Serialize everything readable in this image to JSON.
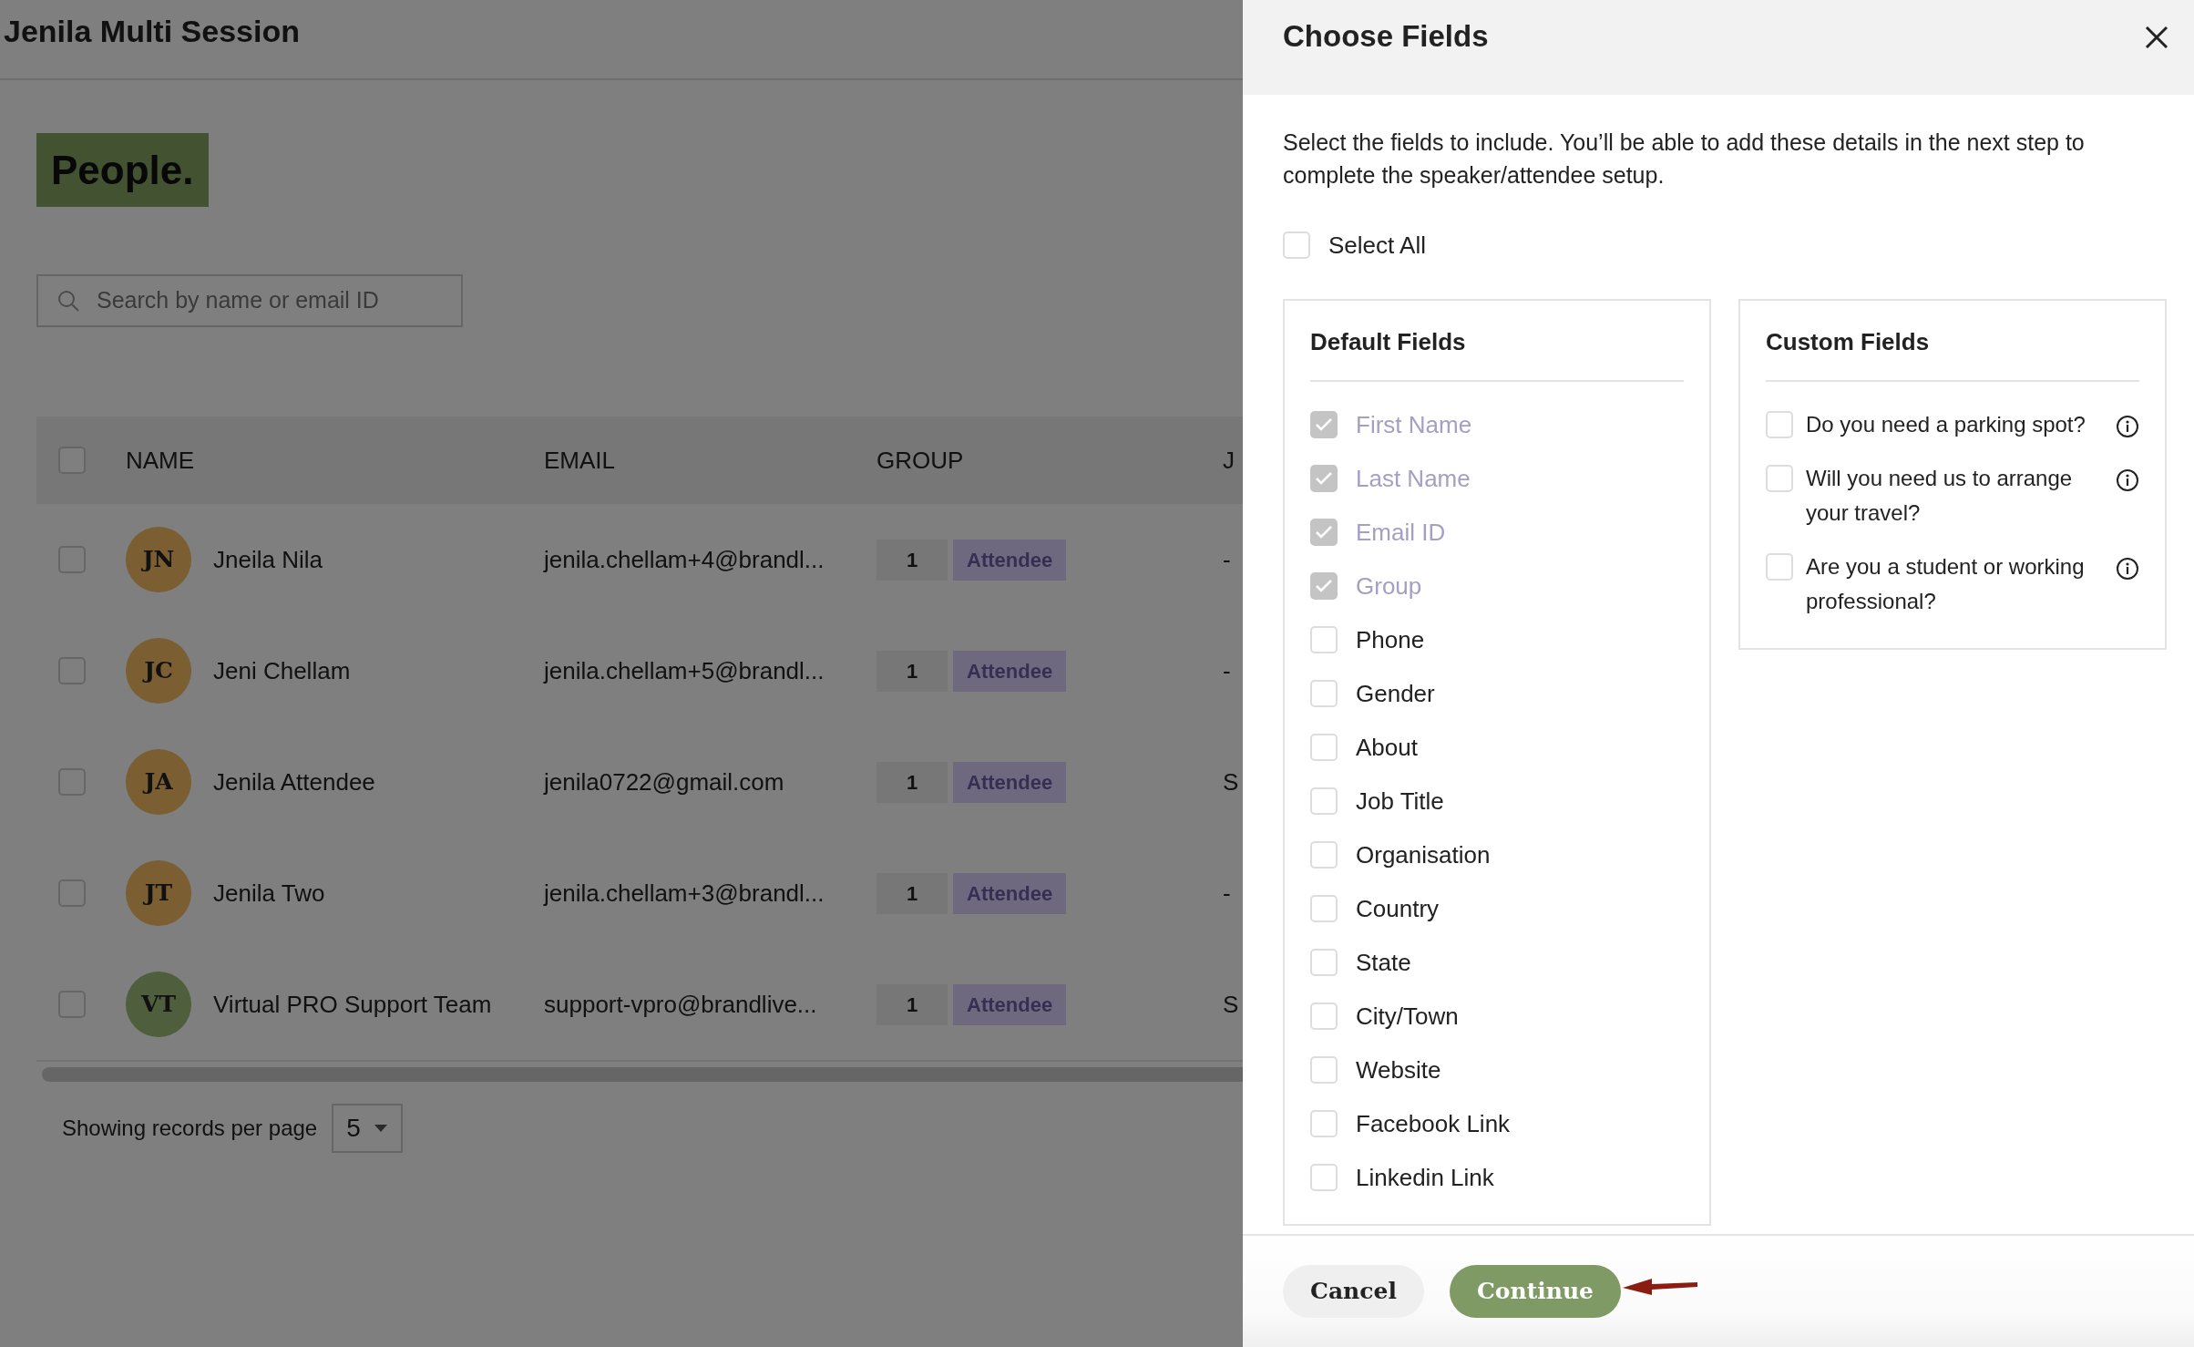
{
  "page": {
    "title": "Jenila Multi Session",
    "heading": "People.",
    "search": {
      "placeholder": "Search by name or email ID"
    },
    "table": {
      "select_all_checked": false,
      "columns": [
        "NAME",
        "EMAIL",
        "GROUP",
        "J"
      ],
      "rows": [
        {
          "checked": false,
          "initials": "JN",
          "color": "#7b5e31",
          "name": "Jneila Nila",
          "email": "jenila.chellam+4@brandl...",
          "group_count": "1",
          "group": "Attendee",
          "column_4": "-"
        },
        {
          "checked": false,
          "initials": "JC",
          "color": "#7b5e31",
          "name": "Jeni Chellam",
          "email": "jenila.chellam+5@brandl...",
          "group_count": "1",
          "group": "Attendee",
          "column_4": "-"
        },
        {
          "checked": false,
          "initials": "JA",
          "color": "#7b5e31",
          "name": "Jenila Attendee",
          "email": "jenila0722@gmail.com",
          "group_count": "1",
          "group": "Attendee",
          "column_4": "S"
        },
        {
          "checked": false,
          "initials": "JT",
          "color": "#7b5e31",
          "name": "Jenila Two",
          "email": "jenila.chellam+3@brandl...",
          "group_count": "1",
          "group": "Attendee",
          "column_4": "-"
        },
        {
          "checked": false,
          "initials": "VT",
          "color": "#4f5e3c",
          "name": "Virtual PRO Support Team",
          "email": "support-vpro@brandlive...",
          "group_count": "1",
          "group": "Attendee",
          "column_4": "S"
        }
      ]
    },
    "pagination": {
      "label": "Showing records per page",
      "per_page": "5"
    }
  },
  "drawer": {
    "title": "Choose Fields",
    "description": "Select the fields to include. You’ll be able to add these details in the next step to complete the speaker/attendee setup.",
    "select_all": {
      "label": "Select All",
      "checked": false
    },
    "default_fields": {
      "title": "Default Fields",
      "items": [
        {
          "label": "First Name",
          "checked": true,
          "disabled": true
        },
        {
          "label": "Last Name",
          "checked": true,
          "disabled": true
        },
        {
          "label": "Email ID",
          "checked": true,
          "disabled": true
        },
        {
          "label": "Group",
          "checked": true,
          "disabled": true
        },
        {
          "label": "Phone",
          "checked": false,
          "disabled": false
        },
        {
          "label": "Gender",
          "checked": false,
          "disabled": false
        },
        {
          "label": "About",
          "checked": false,
          "disabled": false
        },
        {
          "label": "Job Title",
          "checked": false,
          "disabled": false
        },
        {
          "label": "Organisation",
          "checked": false,
          "disabled": false
        },
        {
          "label": "Country",
          "checked": false,
          "disabled": false
        },
        {
          "label": "State",
          "checked": false,
          "disabled": false
        },
        {
          "label": "City/Town",
          "checked": false,
          "disabled": false
        },
        {
          "label": "Website",
          "checked": false,
          "disabled": false
        },
        {
          "label": "Facebook Link",
          "checked": false,
          "disabled": false
        },
        {
          "label": "Linkedin Link",
          "checked": false,
          "disabled": false
        }
      ]
    },
    "custom_fields": {
      "title": "Custom Fields",
      "items": [
        {
          "label": "Do you need a parking spot?",
          "checked": false
        },
        {
          "label": "Will you need us to arrange your travel?",
          "checked": false
        },
        {
          "label": "Are you a student or working professional?",
          "checked": false
        }
      ]
    },
    "buttons": [
      {
        "label": "Cancel",
        "kind": "secondary"
      },
      {
        "label": "Continue",
        "kind": "primary"
      }
    ]
  }
}
